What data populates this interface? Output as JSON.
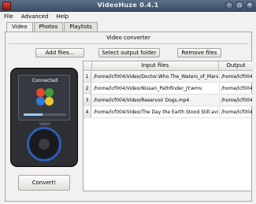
{
  "window": {
    "title": "VideoHuze 0.4.1"
  },
  "menubar": [
    "File",
    "Advanced",
    "Help"
  ],
  "tabs": [
    "Video",
    "Photos",
    "Playlists"
  ],
  "panel": {
    "heading": "Video converter"
  },
  "buttons": {
    "add": "Add files...",
    "select_output": "Select output folder",
    "remove": "Remove files",
    "convert": "Convert!"
  },
  "device": {
    "status": "Connected",
    "brand": "SANSA",
    "progress_fraction": 0.45
  },
  "table": {
    "headers": {
      "input": "Input files",
      "output": "Output folder"
    },
    "rows": [
      {
        "num": "1",
        "input": "/home/lcf004/Video/Doctor.Who.The_Waters_of_Mars.avi",
        "output": "/home/lcf004/"
      },
      {
        "num": "2",
        "input": "/home/lcf004/Video/Nissan_Pathfinder_JY.wmv",
        "output": "/home/lcf004/"
      },
      {
        "num": "3",
        "input": "/home/lcf004/Video/Reservoir Dogs.mp4",
        "output": "/home/lcf004/"
      },
      {
        "num": "4",
        "input": "/home/lcf004/Video/The Day the Earth Stood Still.avi",
        "output": "/home/lcf004/"
      }
    ]
  },
  "colors": {
    "titlebar": "#3d5068",
    "wheel_ring": "#2f5db8"
  }
}
